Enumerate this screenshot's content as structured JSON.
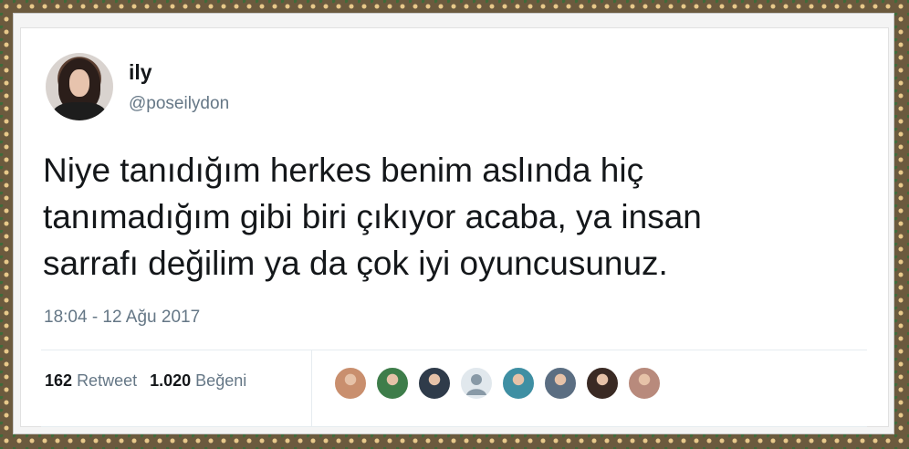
{
  "user": {
    "name": "ily",
    "handle": "@poseilydon"
  },
  "tweet": {
    "text_lines": [
      "Niye tanıdığım herkes benim aslında hiç",
      "tanımadığım gibi biri çıkıyor acaba, ya insan",
      "sarrafı değilim ya da çok iyi oyuncusunuz."
    ],
    "timestamp": "18:04 - 12 Ağu 2017"
  },
  "stats": {
    "retweets_count": "162",
    "retweets_label": "Retweet",
    "likes_count": "1.020",
    "likes_label": "Beğeni"
  },
  "likers": [
    {
      "icon": "liker-avatar-1",
      "color": "#c98f6e"
    },
    {
      "icon": "liker-avatar-2",
      "color": "#3e7d4a"
    },
    {
      "icon": "liker-avatar-3",
      "color": "#2f3b4a"
    },
    {
      "icon": "default-avatar-icon",
      "color": "#ccd6dd"
    },
    {
      "icon": "liker-avatar-5",
      "color": "#3f8fa3"
    },
    {
      "icon": "liker-avatar-6",
      "color": "#5b6e82"
    },
    {
      "icon": "liker-avatar-7",
      "color": "#3a2a24"
    },
    {
      "icon": "liker-avatar-8",
      "color": "#b88a7c"
    }
  ]
}
